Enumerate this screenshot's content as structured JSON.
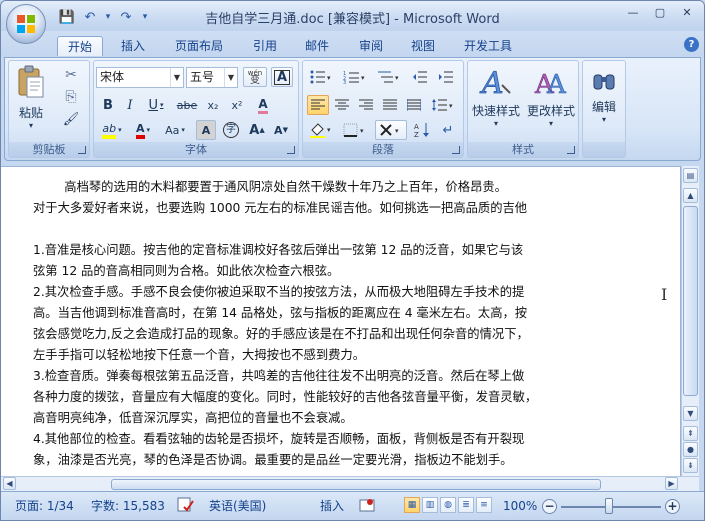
{
  "window": {
    "title": "吉他自学三月通.doc [兼容模式] - Microsoft Word",
    "controls": {
      "minimize": "—",
      "maximize": "▢",
      "close": "✕"
    }
  },
  "quick_access": {
    "save_icon": "💾",
    "undo_icon": "↶",
    "redo_icon": "↷",
    "customize_icon": "▾"
  },
  "tabs": [
    "开始",
    "插入",
    "页面布局",
    "引用",
    "邮件",
    "审阅",
    "视图",
    "开发工具"
  ],
  "active_tab": "开始",
  "ribbon": {
    "clipboard": {
      "label": "剪贴板",
      "paste": "粘贴",
      "cut_icon": "✂",
      "copy_icon": "⎘",
      "format_painter_icon": "🖌"
    },
    "font": {
      "label": "字体",
      "font_name": "宋体",
      "font_size": "五号",
      "phonetic_label": "wén",
      "phonetic_char": "变",
      "border_char": "A",
      "bold": "B",
      "italic": "I",
      "underline": "U",
      "strike": "abe",
      "subscript": "x₂",
      "superscript": "x²",
      "clear_format": "A",
      "highlight": "ab",
      "font_color": "A",
      "change_case": "Aa",
      "char_shading": "A",
      "enclose": "字",
      "grow": "A",
      "shrink": "A",
      "highlight_color": "#ffff00",
      "font_color_value": "#e00000"
    },
    "paragraph": {
      "label": "段落"
    },
    "styles": {
      "label": "样式",
      "quick_styles": "快速样式",
      "change_styles": "更改样式"
    },
    "editing": {
      "label": "编辑",
      "find": "编辑"
    }
  },
  "document": {
    "lines": [
      "        高档琴的选用的木料都要置于通风阴凉处自然干燥数十年乃之上百年，价格昂贵。",
      "对于大多爱好者来说，也要选购 1000 元左右的标准民谣吉他。如何挑选一把高品质的吉他",
      "",
      "1.音准是核心问题。按吉他的定音标准调校好各弦后弹出一弦第 12 品的泛音，如果它与该",
      "弦第 12 品的音高相同则为合格。如此依次检查六根弦。",
      "2.其次检查手感。手感不良会使你被迫采取不当的按弦方法，从而极大地阻碍左手技术的提",
      "高。当吉他调到标准音高时，在第 14 品格处，弦与指板的距离应在 4 毫米左右。太高，按",
      "弦会感觉吃力,反之会造成打品的现象。好的手感应该是在不打品和出现任何杂音的情况下，",
      "左手手指可以轻松地按下任意一个音，大拇按也不感到费力。",
      "3.检查音质。弹奏每根弦第五品泛音，共鸣差的吉他往往发不出明亮的泛音。然后在琴上做",
      "各种力度的拨弦，音量应有大幅度的变化。同时，性能较好的吉他各弦音量平衡，发音灵敏，",
      "高音明亮纯净，低音深沉厚实，高把位的音量也不会衰减。",
      "4.其他部位的检查。看看弦轴的齿轮是否损坏，旋转是否顺畅，面板，背侧板是否有开裂现",
      "象，油漆是否光亮，琴的色泽是否协调。最重要的是品丝一定要光滑，指板边不能划手。"
    ]
  },
  "status": {
    "page": "页面: 1/34",
    "words": "字数: 15,583",
    "language": "英语(美国)",
    "insert_mode": "插入",
    "zoom": "100%",
    "zoom_minus": "−",
    "zoom_plus": "+"
  }
}
